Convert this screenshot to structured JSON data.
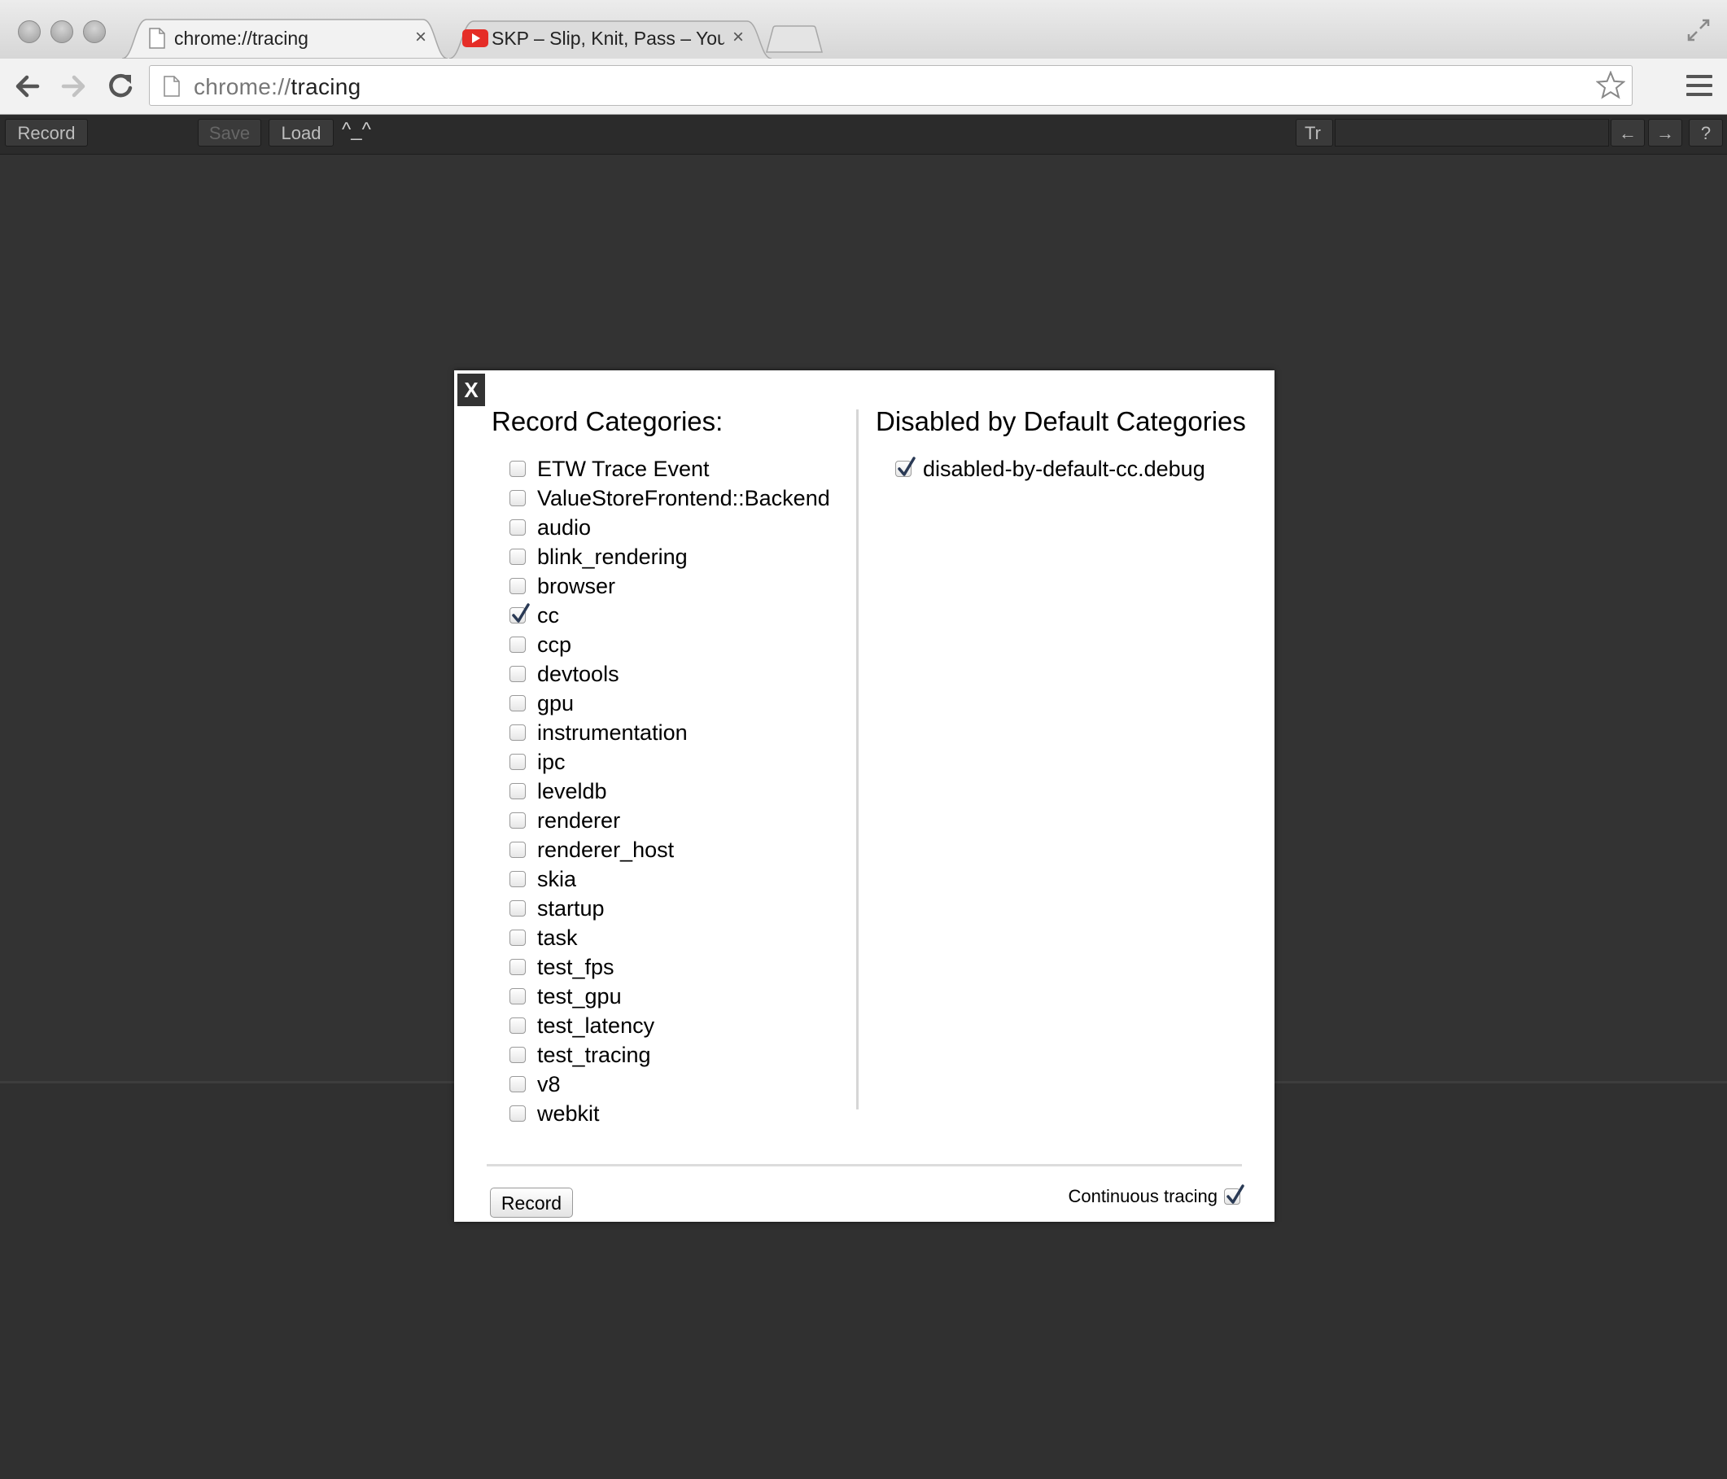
{
  "browser": {
    "tabs": [
      {
        "title": "chrome://tracing",
        "active": true,
        "icon": "page-icon"
      },
      {
        "title": "SKP – Slip, Knit, Pass – You",
        "active": false,
        "icon": "youtube-icon"
      }
    ],
    "close_glyph": "×",
    "url_scheme": "chrome://",
    "url_path": "tracing"
  },
  "tracing_toolbar": {
    "record_label": "Record",
    "save_label": "Save",
    "load_label": "Load",
    "caret_text": "^_^",
    "search_prefix": "Tr",
    "prev_glyph": "←",
    "next_glyph": "→",
    "help_glyph": "?"
  },
  "dialog": {
    "close_label": "X",
    "record_categories_title": "Record Categories:",
    "disabled_categories_title": "Disabled by Default Categories",
    "categories": [
      {
        "label": "ETW Trace Event",
        "checked": false
      },
      {
        "label": "ValueStoreFrontend::Backend",
        "checked": false
      },
      {
        "label": "audio",
        "checked": false
      },
      {
        "label": "blink_rendering",
        "checked": false
      },
      {
        "label": "browser",
        "checked": false
      },
      {
        "label": "cc",
        "checked": true
      },
      {
        "label": "ccp",
        "checked": false
      },
      {
        "label": "devtools",
        "checked": false
      },
      {
        "label": "gpu",
        "checked": false
      },
      {
        "label": "instrumentation",
        "checked": false
      },
      {
        "label": "ipc",
        "checked": false
      },
      {
        "label": "leveldb",
        "checked": false
      },
      {
        "label": "renderer",
        "checked": false
      },
      {
        "label": "renderer_host",
        "checked": false
      },
      {
        "label": "skia",
        "checked": false
      },
      {
        "label": "startup",
        "checked": false
      },
      {
        "label": "task",
        "checked": false
      },
      {
        "label": "test_fps",
        "checked": false
      },
      {
        "label": "test_gpu",
        "checked": false
      },
      {
        "label": "test_latency",
        "checked": false
      },
      {
        "label": "test_tracing",
        "checked": false
      },
      {
        "label": "v8",
        "checked": false
      },
      {
        "label": "webkit",
        "checked": false
      }
    ],
    "disabled_categories": [
      {
        "label": "disabled-by-default-cc.debug",
        "checked": true
      }
    ],
    "record_button_label": "Record",
    "continuous_tracing_label": "Continuous tracing",
    "continuous_tracing_checked": true
  },
  "colors": {
    "page_background": "#333333",
    "checkmark": "#2a3a55",
    "youtube_red": "#e52d27"
  }
}
